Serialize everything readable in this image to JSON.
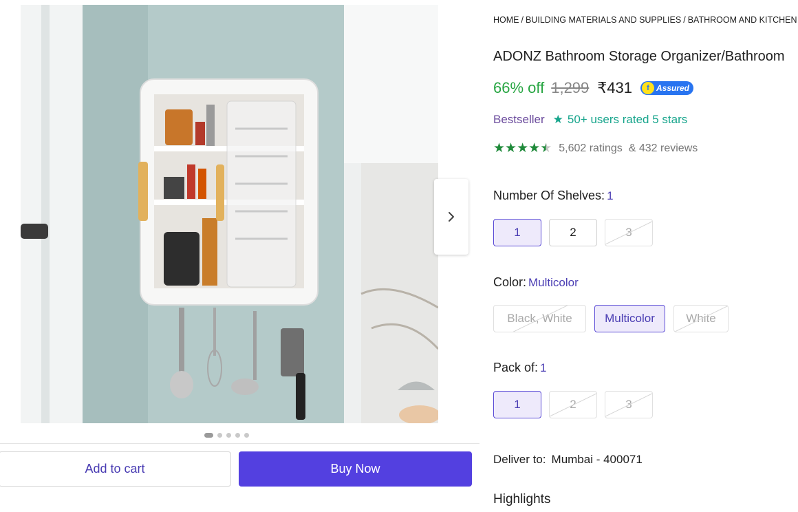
{
  "gallery": {
    "image_alt": "Wall-mounted bathroom storage organizer cabinet with hooks",
    "dots_count": 5,
    "active_dot": 0,
    "next_icon": "chevron-right-icon"
  },
  "actions": {
    "add_to_cart": "Add to cart",
    "buy_now": "Buy Now",
    "buy_now_color": "#5340e0"
  },
  "breadcrumb": [
    "HOME",
    "BUILDING MATERIALS AND SUPPLIES",
    "BATHROOM AND KITCHEN"
  ],
  "product": {
    "title": "ADONZ Bathroom Storage Organizer/Bathroom",
    "discount": "66% off",
    "mrp": "1,299",
    "price": "₹431",
    "assured_label": "Assured",
    "bestseller": "Bestseller",
    "rated_text": "50+ users rated 5 stars",
    "rating_value": 4.5,
    "ratings_count": "5,602 ratings",
    "reviews_count": "& 432 reviews"
  },
  "variants": {
    "shelves": {
      "label": "Number Of Shelves:",
      "selected": "1",
      "options": [
        {
          "label": "1",
          "state": "selected"
        },
        {
          "label": "2",
          "state": "available"
        },
        {
          "label": "3",
          "state": "disabled"
        }
      ]
    },
    "color": {
      "label": "Color:",
      "selected": "Multicolor",
      "options": [
        {
          "label": "Black, White",
          "state": "disabled"
        },
        {
          "label": "Multicolor",
          "state": "selected"
        },
        {
          "label": "White",
          "state": "disabled"
        }
      ]
    },
    "pack": {
      "label": "Pack of:",
      "selected": "1",
      "options": [
        {
          "label": "1",
          "state": "selected"
        },
        {
          "label": "2",
          "state": "disabled"
        },
        {
          "label": "3",
          "state": "disabled"
        }
      ]
    }
  },
  "delivery": {
    "label": "Deliver to:",
    "location": "Mumbai - 400071"
  },
  "highlights_heading": "Highlights"
}
